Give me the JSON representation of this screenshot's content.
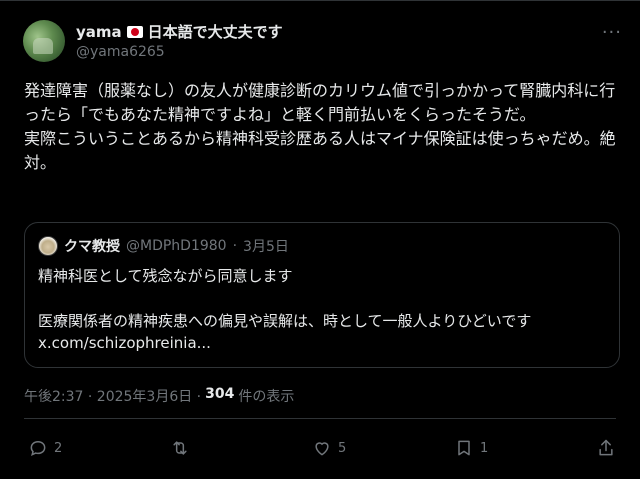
{
  "author": {
    "name_prefix": "yama",
    "name_suffix": "日本語で大丈夫です",
    "handle": "@yama6265",
    "flag_icon": "japan-flag"
  },
  "post": {
    "paragraph1": "発達障害（服薬なし）の友人が健康診断のカリウム値で引っかかって腎臓内科に行ったら「でもあなた精神ですよね」と軽く門前払いをくらったそうだ。",
    "paragraph2": "実際こういうことあるから精神科受診歴ある人はマイナ保険証は使っちゃだめ。絶対。"
  },
  "quote": {
    "name": "クマ教授",
    "handle": "@MDPhD1980",
    "separator": "·",
    "date": "3月5日",
    "line1": "精神科医として残念ながら同意します",
    "line2": "医療関係者の精神疾患への偏見や誤解は、時として一般人よりひどいです",
    "line3": "x.com/schizophreinia..."
  },
  "meta": {
    "time_date": "午後2:37 · 2025年3月6日 ·",
    "views": "304",
    "views_label": "件の表示"
  },
  "actions": {
    "reply_count": "2",
    "repost_count": "",
    "like_count": "5",
    "bookmark_count": "1"
  },
  "colors": {
    "background": "#000000",
    "text": "#e7e9ea",
    "muted": "#71767b",
    "border": "#2f3336"
  }
}
